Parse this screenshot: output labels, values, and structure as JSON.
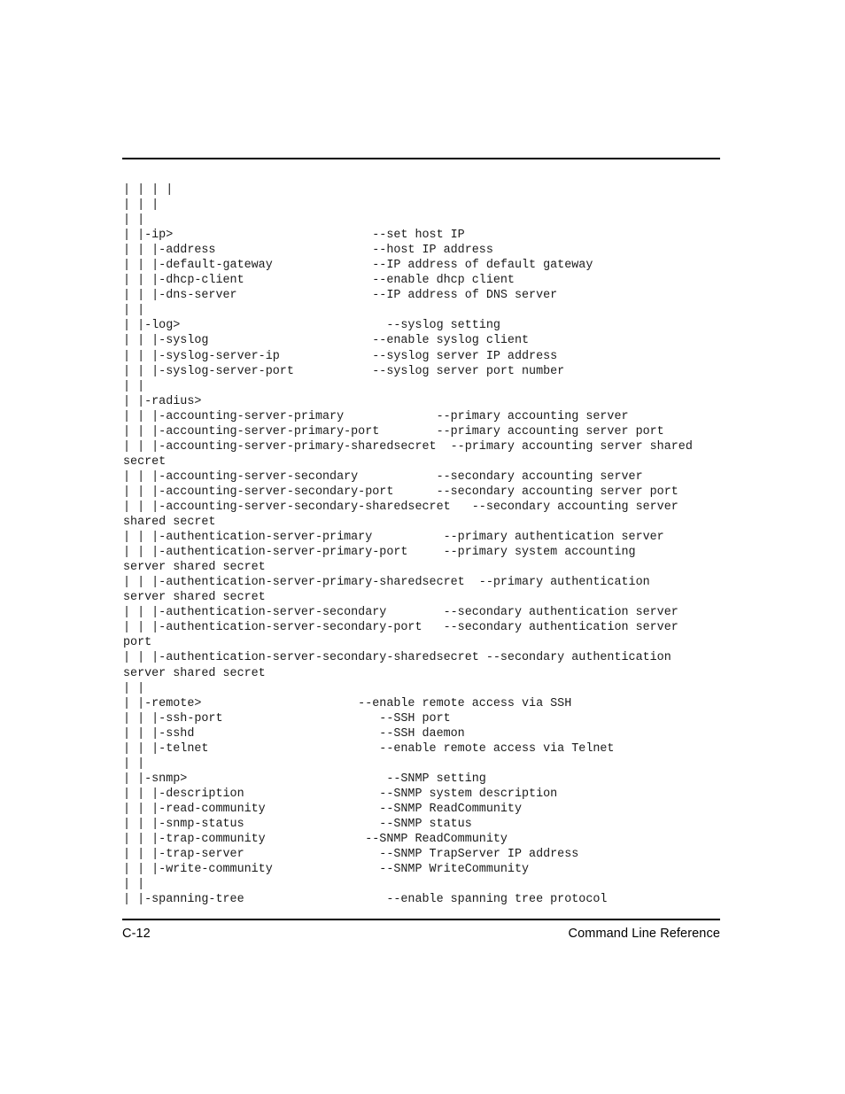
{
  "page": {
    "footer_page_number": "C-12",
    "footer_title": "Command Line Reference"
  },
  "command_tree": {
    "lines": [
      "| | | |",
      "| | |",
      "| |",
      "| |-ip>                            --set host IP",
      "| | |-address                      --host IP address",
      "| | |-default-gateway              --IP address of default gateway",
      "| | |-dhcp-client                  --enable dhcp client",
      "| | |-dns-server                   --IP address of DNS server",
      "| |",
      "| |-log>                             --syslog setting",
      "| | |-syslog                       --enable syslog client",
      "| | |-syslog-server-ip             --syslog server IP address",
      "| | |-syslog-server-port           --syslog server port number",
      "| |",
      "| |-radius>",
      "| | |-accounting-server-primary             --primary accounting server",
      "| | |-accounting-server-primary-port        --primary accounting server port",
      "| | |-accounting-server-primary-sharedsecret  --primary accounting server shared",
      "secret",
      "| | |-accounting-server-secondary           --secondary accounting server",
      "| | |-accounting-server-secondary-port      --secondary accounting server port",
      "| | |-accounting-server-secondary-sharedsecret   --secondary accounting server",
      "shared secret",
      "| | |-authentication-server-primary          --primary authentication server",
      "| | |-authentication-server-primary-port     --primary system accounting",
      "server shared secret",
      "| | |-authentication-server-primary-sharedsecret  --primary authentication",
      "server shared secret",
      "| | |-authentication-server-secondary        --secondary authentication server",
      "| | |-authentication-server-secondary-port   --secondary authentication server",
      "port",
      "| | |-authentication-server-secondary-sharedsecret --secondary authentication",
      "server shared secret",
      "| |",
      "| |-remote>                      --enable remote access via SSH",
      "| | |-ssh-port                      --SSH port",
      "| | |-sshd                          --SSH daemon",
      "| | |-telnet                        --enable remote access via Telnet",
      "| |",
      "| |-snmp>                            --SNMP setting",
      "| | |-description                   --SNMP system description",
      "| | |-read-community                --SNMP ReadCommunity",
      "| | |-snmp-status                   --SNMP status",
      "| | |-trap-community              --SNMP ReadCommunity",
      "| | |-trap-server                   --SNMP TrapServer IP address",
      "| | |-write-community               --SNMP WriteCommunity",
      "| |",
      "| |-spanning-tree                    --enable spanning tree protocol"
    ]
  }
}
